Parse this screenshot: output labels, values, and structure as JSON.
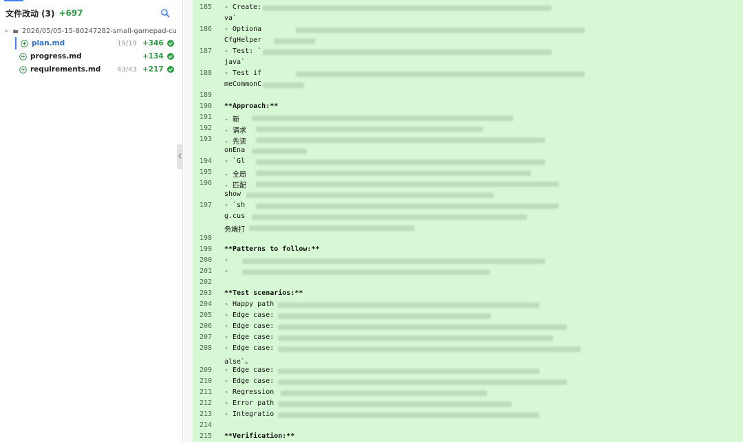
{
  "sidebar": {
    "title": "文件改动 (3)",
    "total_additions": "+697",
    "folder": "2026/05/05-15-80247282-small-gamepad-cu",
    "files": [
      {
        "name": "plan.md",
        "count": "19/19",
        "additions": "+346",
        "active": true
      },
      {
        "name": "progress.md",
        "count": "",
        "additions": "+134",
        "active": false
      },
      {
        "name": "requirements.md",
        "count": "43/43",
        "additions": "+217",
        "active": false
      }
    ]
  },
  "editor": {
    "lines": [
      {
        "num": "185",
        "text": "- Create: "
      },
      {
        "num": "186",
        "text": "- Optiona"
      },
      {
        "num": "187",
        "text": "- Test: `"
      },
      {
        "num": "188",
        "text": "- Test if"
      },
      {
        "num": "189",
        "text": ""
      },
      {
        "num": "190",
        "text": "**Approach:**"
      },
      {
        "num": "191",
        "text": "- 新"
      },
      {
        "num": "192",
        "text": "- 请求"
      },
      {
        "num": "193",
        "text": "- 先读"
      },
      {
        "num": "194",
        "text": "- `Gl"
      },
      {
        "num": "195",
        "text": "- 全局"
      },
      {
        "num": "196",
        "text": "- 匹配"
      },
      {
        "num": "197",
        "text": "- `sh"
      },
      {
        "num": "198",
        "text": ""
      },
      {
        "num": "199",
        "text": "**Patterns to follow:**"
      },
      {
        "num": "200",
        "text": "- "
      },
      {
        "num": "201",
        "text": "- "
      },
      {
        "num": "202",
        "text": ""
      },
      {
        "num": "203",
        "text": "**Test scenarios:**"
      },
      {
        "num": "204",
        "text": "- Happy path"
      },
      {
        "num": "205",
        "text": "- Edge case:"
      },
      {
        "num": "206",
        "text": "- Edge case:"
      },
      {
        "num": "207",
        "text": "- Edge case:"
      },
      {
        "num": "208",
        "text": "- Edge case:"
      },
      {
        "num": "209",
        "text": "- Edge case:"
      },
      {
        "num": "210",
        "text": "- Edge case:"
      },
      {
        "num": "211",
        "text": "- Regression"
      },
      {
        "num": "212",
        "text": "- Error path"
      },
      {
        "num": "213",
        "text": "- Integratio"
      },
      {
        "num": "214",
        "text": ""
      },
      {
        "num": "215",
        "text": "**Verification:**"
      }
    ],
    "wraps": [
      {
        "after": "185",
        "text": "va`"
      },
      {
        "after": "186",
        "text": "CfgHelper"
      },
      {
        "after": "187",
        "text": "java`"
      },
      {
        "after": "188",
        "text": "meCommonC"
      },
      {
        "after": "193",
        "text": "onEna"
      },
      {
        "after": "196",
        "text": "show"
      },
      {
        "after": "197a",
        "text": "g.cus"
      },
      {
        "after": "197b",
        "text": "务端打"
      },
      {
        "after": "208",
        "text": "alse`。"
      }
    ]
  },
  "colors": {
    "accent": "#3b82f6",
    "added": "#2e9e44",
    "diff_bg": "#d7f8d4"
  }
}
